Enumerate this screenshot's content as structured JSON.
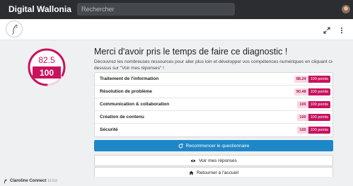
{
  "app": {
    "brand": "Digital Wallonia",
    "search_placeholder": "Rechercher"
  },
  "score": {
    "value": "82.5",
    "max": "100",
    "fraction": 0.825,
    "accent": "#c8125e"
  },
  "main": {
    "title": "Merci d'avoir pris le temps de faire ce diagnostic !",
    "description": "Découvrez les nombreuses ressources pour aller plus loin et développer vos compétences numériques en cliquant ci-dessous sur \"Voir mes réponses\" !"
  },
  "results": [
    {
      "label": "Traitement de l'information",
      "score": "88.24",
      "points": "100 points"
    },
    {
      "label": "Résolution de problème",
      "score": "90.48",
      "points": "100 points"
    },
    {
      "label": "Communication & collaboration",
      "score": "100",
      "points": "100 points"
    },
    {
      "label": "Création de contenu",
      "score": "100",
      "points": "100 points"
    },
    {
      "label": "Sécurité",
      "score": "100",
      "points": "100 points"
    }
  ],
  "actions": {
    "restart": "Recommencer le questionnaire",
    "answers": "Voir mes réponses",
    "home": "Retourner à l'accueil"
  },
  "footer": {
    "product": "Claroline Connect",
    "version": "13.0.0"
  },
  "colors": {
    "topbar": "#2b2d30",
    "primary": "#1e87c7",
    "accent": "#c8125e"
  },
  "icons": [
    "expand-icon",
    "more-vertical-icon",
    "redo-icon",
    "eye-icon",
    "home-icon",
    "claroline-logo"
  ]
}
